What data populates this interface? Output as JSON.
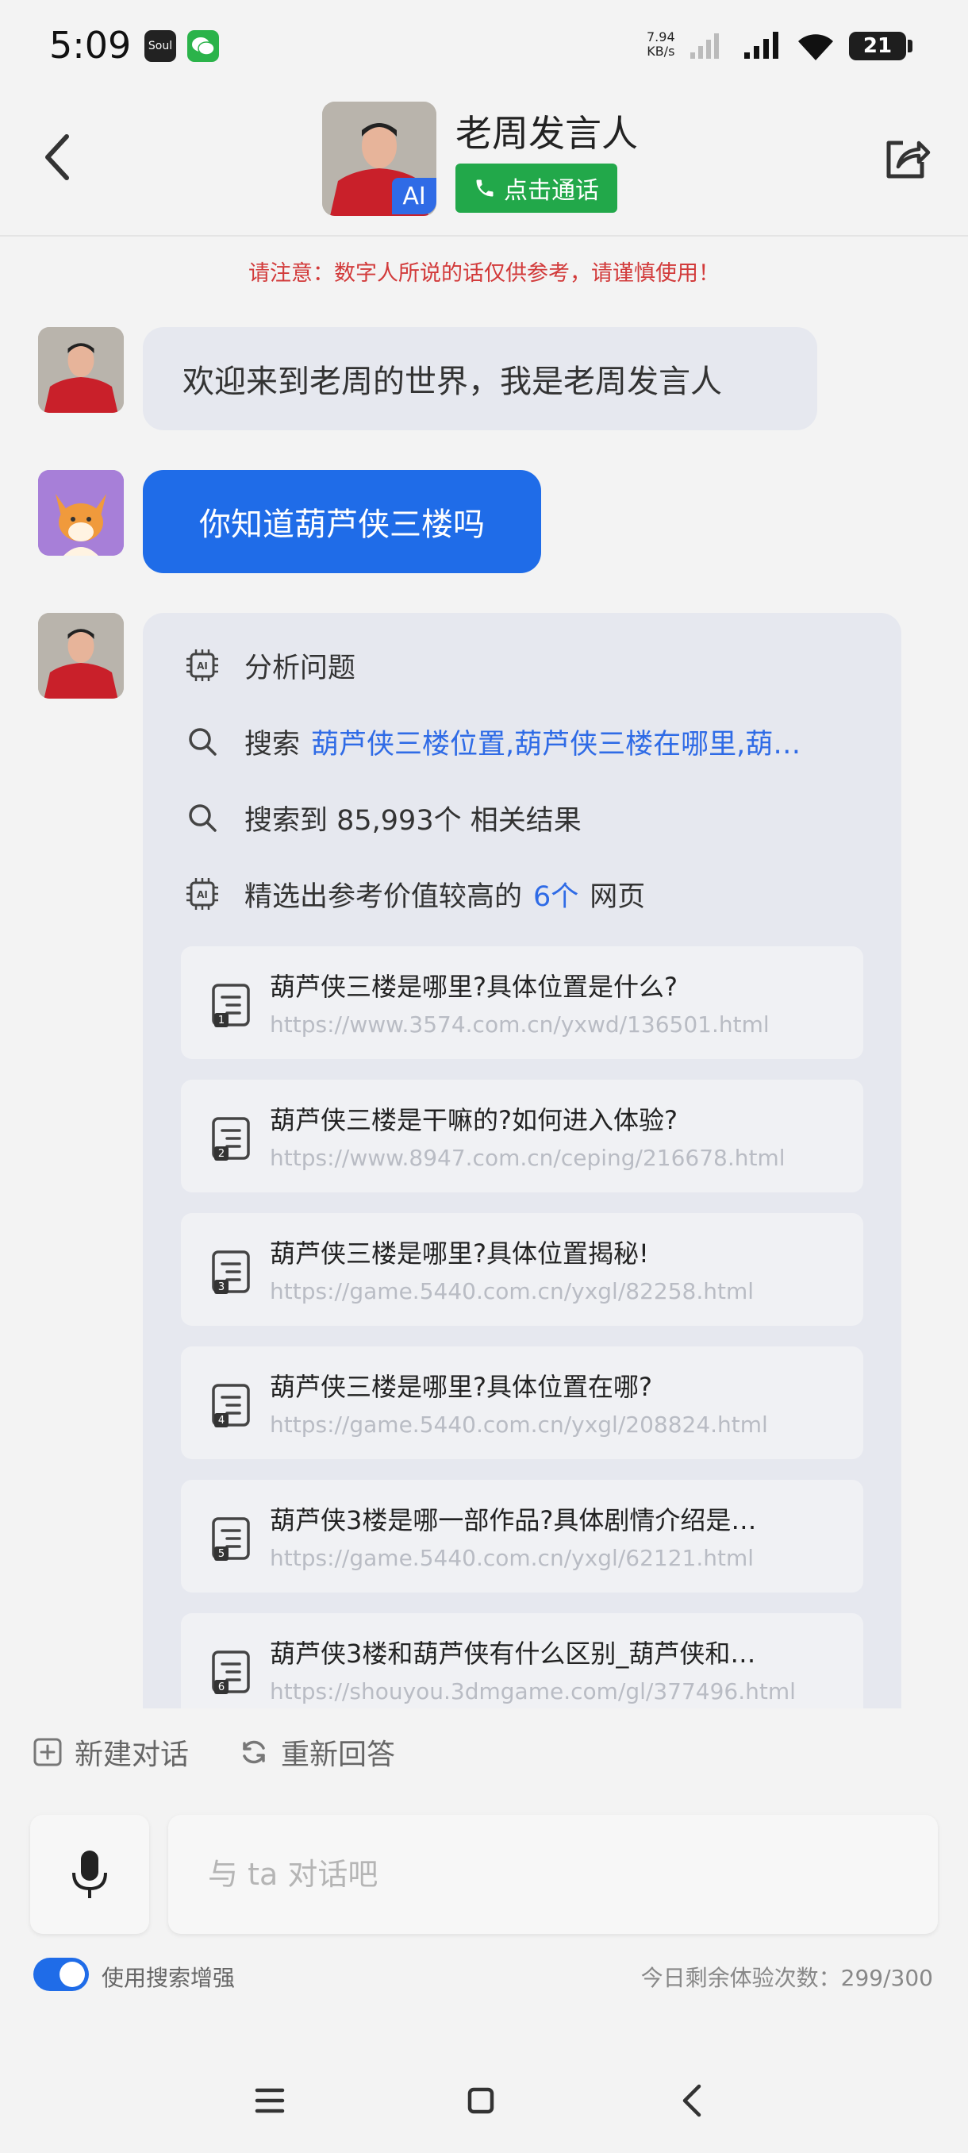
{
  "status_bar": {
    "time": "5:09",
    "soul_app_label": "Soul",
    "net_speed_value": "7.94",
    "net_speed_unit": "KB/s",
    "battery": "21"
  },
  "header": {
    "title": "老周发言人",
    "ai_badge": "AI",
    "call_label": "点击通话"
  },
  "notice": "请注意：数字人所说的话仅供参考，请谨慎使用！",
  "messages": {
    "bot_greeting": "欢迎来到老周的世界，我是老周发言人",
    "user_question": "你知道葫芦侠三楼吗"
  },
  "answer": {
    "step1": "分析问题",
    "step2_prefix": "搜索",
    "step2_query": "葫芦侠三楼位置,葫芦侠三楼在哪里,葫…",
    "step3": "搜索到 85,993个 相关结果",
    "step4_prefix": "精选出参考价值较高的",
    "step4_count": "6个",
    "step4_suffix": "网页",
    "results": [
      {
        "num": "1",
        "title": "葫芦侠三楼是哪里?具体位置是什么?",
        "url": "https://www.3574.com.cn/yxwd/136501.html"
      },
      {
        "num": "2",
        "title": "葫芦侠三楼是干嘛的?如何进入体验?",
        "url": "https://www.8947.com.cn/ceping/216678.html"
      },
      {
        "num": "3",
        "title": "葫芦侠三楼是哪里?具体位置揭秘!",
        "url": "https://game.5440.com.cn/yxgl/82258.html"
      },
      {
        "num": "4",
        "title": "葫芦侠三楼是哪里?具体位置在哪?",
        "url": "https://game.5440.com.cn/yxgl/208824.html"
      },
      {
        "num": "5",
        "title": "葫芦侠3楼是哪一部作品?具体剧情介绍是…",
        "url": "https://game.5440.com.cn/yxgl/62121.html"
      },
      {
        "num": "6",
        "title": "葫芦侠3楼和葫芦侠有什么区别_葫芦侠和…",
        "url": "https://shouyou.3dmgame.com/gl/377496.html"
      }
    ]
  },
  "actions": {
    "new_chat": "新建对话",
    "regenerate": "重新回答"
  },
  "input": {
    "placeholder": "与 ta 对话吧"
  },
  "footer": {
    "search_toggle_label": "使用搜索增强",
    "search_toggle_on": true,
    "remaining_label": "今日剩余体验次数：299/300"
  },
  "colors": {
    "accent": "#1f6ce8",
    "call_green": "#22a84a",
    "notice_red": "#d23a3a",
    "bubble_gray": "#e6e8ef"
  }
}
